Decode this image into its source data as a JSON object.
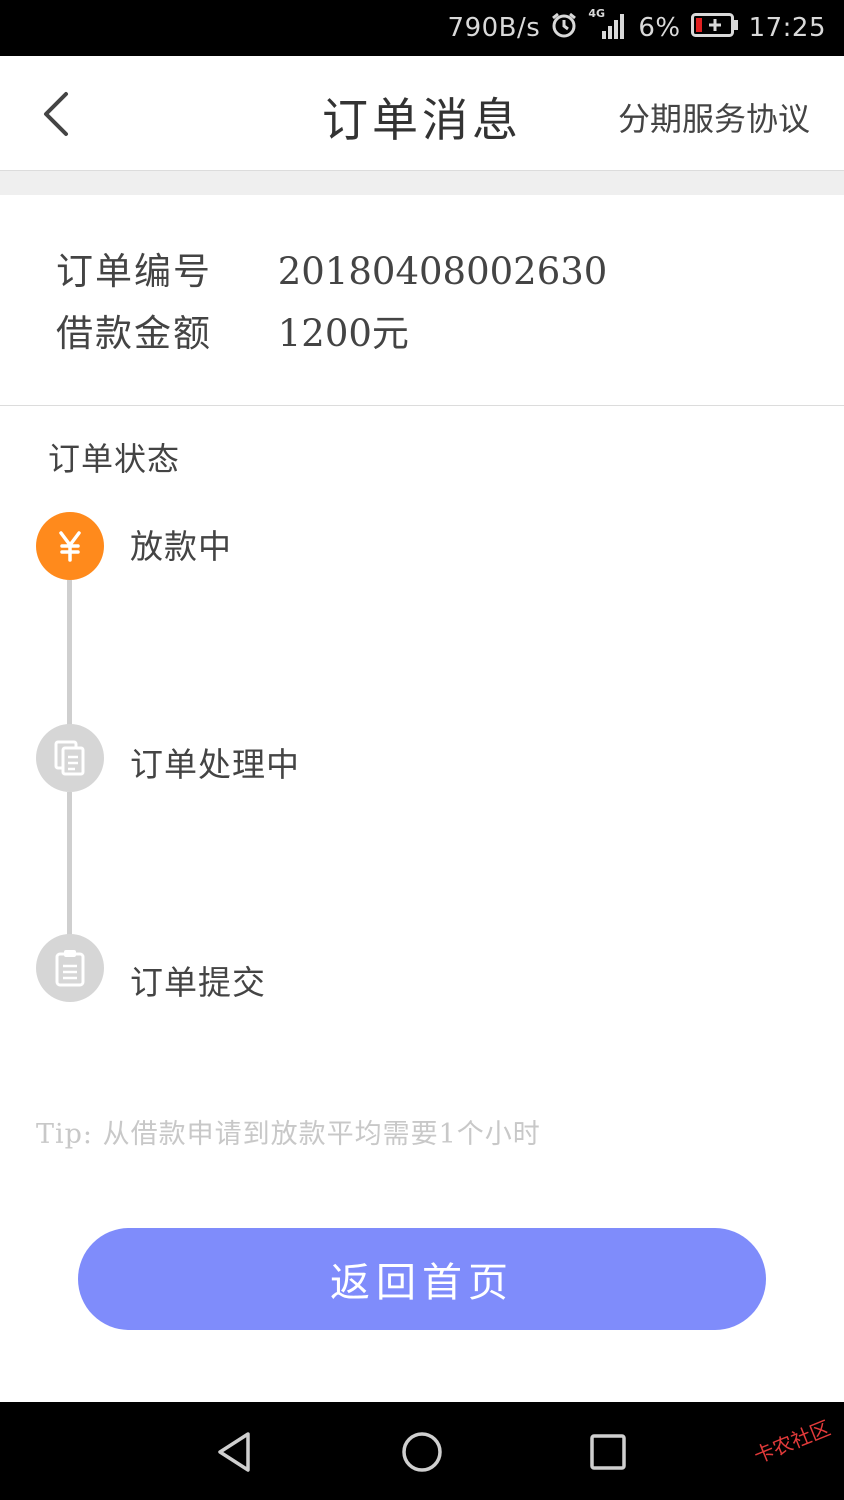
{
  "status_bar": {
    "network_speed": "790B/s",
    "network_type": "4G",
    "battery_percent": "6%",
    "time": "17:25"
  },
  "header": {
    "title": "订单消息",
    "right_link": "分期服务协议"
  },
  "order_info": {
    "order_number_label": "订单编号",
    "order_number": "20180408002630",
    "amount_label": "借款金额",
    "amount": "1200元"
  },
  "order_status": {
    "title": "订单状态",
    "steps": [
      {
        "label": "放款中",
        "icon": "yen-icon",
        "active": true
      },
      {
        "label": "订单处理中",
        "icon": "documents-icon",
        "active": false
      },
      {
        "label": "订单提交",
        "icon": "clipboard-icon",
        "active": false
      }
    ]
  },
  "tip": "Tip: 从借款申请到放款平均需要1个小时",
  "home_button": "返回首页",
  "watermark": "卡农社区",
  "colors": {
    "accent_orange": "#ff8a1c",
    "button_blue": "#7f8cfb",
    "inactive_gray": "#d6d6d6"
  }
}
